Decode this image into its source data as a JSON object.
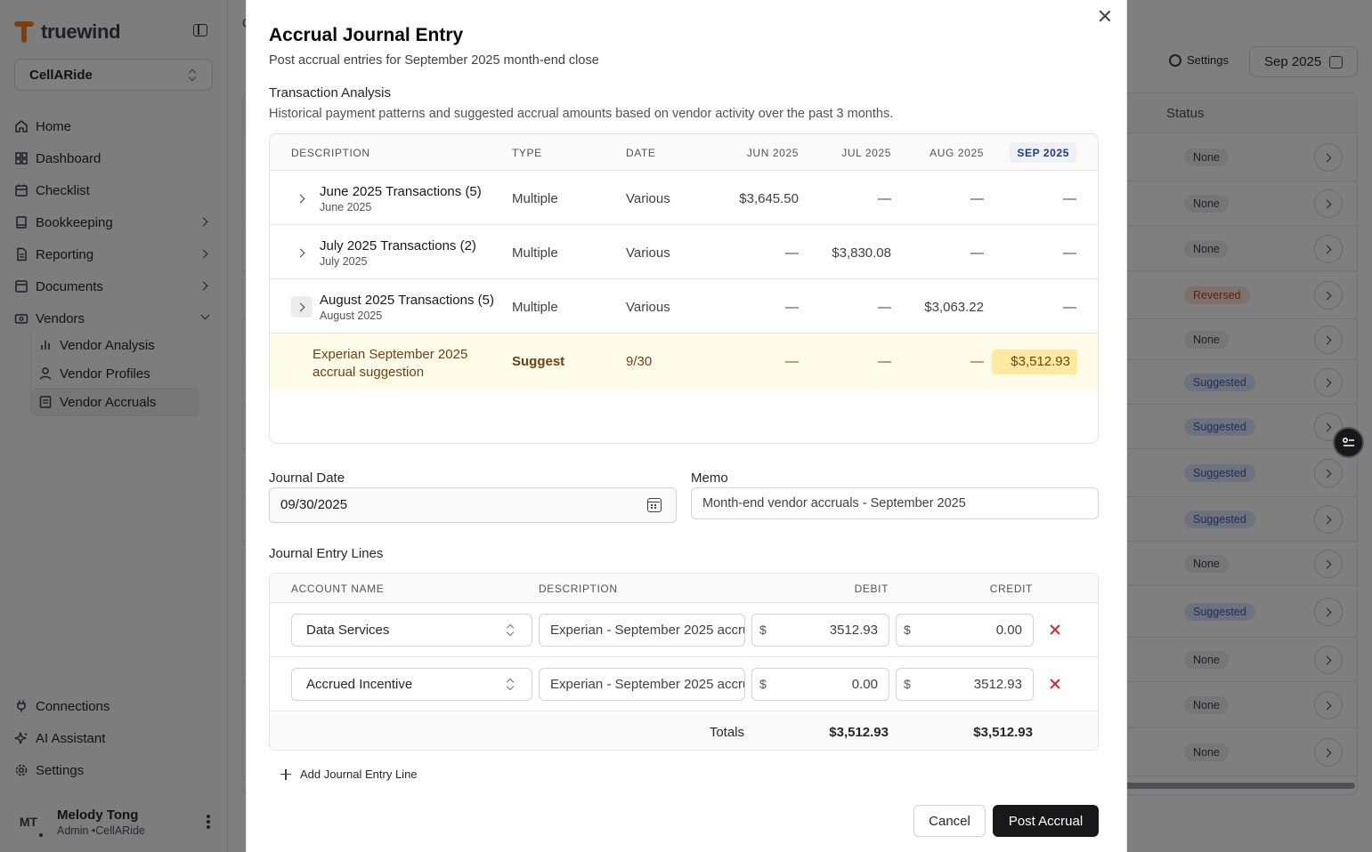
{
  "app": {
    "brand": "truewind",
    "company": "CellARide"
  },
  "sidebar": {
    "items": [
      {
        "label": "Home"
      },
      {
        "label": "Dashboard"
      },
      {
        "label": "Checklist"
      },
      {
        "label": "Bookkeeping"
      },
      {
        "label": "Reporting"
      },
      {
        "label": "Documents"
      },
      {
        "label": "Vendors"
      }
    ],
    "vendor_sub": [
      {
        "label": "Vendor Analysis"
      },
      {
        "label": "Vendor Profiles"
      },
      {
        "label": "Vendor Accruals"
      }
    ],
    "bottom": [
      {
        "label": "Connections"
      },
      {
        "label": "AI Assistant"
      },
      {
        "label": "Settings"
      }
    ],
    "user": {
      "initials": "MT",
      "name": "Melody Tong",
      "role": "Admin •CellARide"
    }
  },
  "background": {
    "crumb": "C",
    "settings_label": "Settings",
    "month": "Sep 2025",
    "status_header": "Status",
    "statuses": [
      "None",
      "None",
      "None",
      "Reversed",
      "None",
      "Suggested",
      "Suggested",
      "Suggested",
      "Suggested",
      "None",
      "Suggested",
      "None",
      "None",
      "None"
    ]
  },
  "dialog": {
    "title": "Accrual Journal Entry",
    "subtitle": "Post accrual entries for September 2025 month-end close",
    "analysis": {
      "title": "Transaction Analysis",
      "description": "Historical payment patterns and suggested accrual amounts based on vendor activity over the past 3 months.",
      "headers": {
        "description": "DESCRIPTION",
        "type": "TYPE",
        "date": "DATE",
        "jun": "JUN 2025",
        "jul": "JUL 2025",
        "aug": "AUG 2025",
        "sep": "SEP 2025"
      },
      "rows": [
        {
          "title": "June 2025 Transactions (5)",
          "sub": "June 2025",
          "type": "Multiple",
          "date": "Various",
          "jun": "$3,645.50",
          "jul": "—",
          "aug": "—",
          "sep": "—"
        },
        {
          "title": "July 2025 Transactions (2)",
          "sub": "July 2025",
          "type": "Multiple",
          "date": "Various",
          "jun": "—",
          "jul": "$3,830.08",
          "aug": "—",
          "sep": "—"
        },
        {
          "title": "August 2025 Transactions (5)",
          "sub": "August 2025",
          "type": "Multiple",
          "date": "Various",
          "jun": "—",
          "jul": "—",
          "aug": "$3,063.22",
          "sep": "—"
        }
      ],
      "suggestion": {
        "description": "Experian September 2025 accrual suggestion",
        "type": "Suggest",
        "date": "9/30",
        "jun": "—",
        "jul": "—",
        "aug": "—",
        "sep": "$3,512.93"
      }
    },
    "journal_date": {
      "label": "Journal Date",
      "value": "09/30/2025"
    },
    "memo": {
      "label": "Memo",
      "value": "Month-end vendor accruals - September 2025"
    },
    "lines": {
      "title": "Journal Entry Lines",
      "headers": {
        "account": "ACCOUNT NAME",
        "description": "DESCRIPTION",
        "debit": "DEBIT",
        "credit": "CREDIT"
      },
      "currency": "$",
      "rows": [
        {
          "account": "Data Services",
          "description": "Experian - September 2025 accrual",
          "debit": "3512.93",
          "credit": "0.00"
        },
        {
          "account": "Accrued Incentive",
          "description": "Experian - September 2025 accrual",
          "debit": "0.00",
          "credit": "3512.93"
        }
      ],
      "totals": {
        "label": "Totals",
        "debit": "$3,512.93",
        "credit": "$3,512.93"
      },
      "add_label": "Add Journal Entry Line"
    },
    "buttons": {
      "cancel": "Cancel",
      "post": "Post Accrual"
    }
  }
}
